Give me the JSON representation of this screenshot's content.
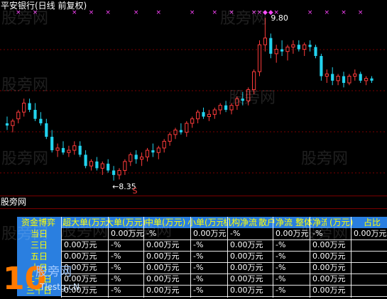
{
  "header": {
    "title": "平安银行(日线 前复权)"
  },
  "chart": {
    "high_label": "9.80",
    "low_label": "←8.35",
    "marker_label": "S",
    "colors": {
      "up": "#ff3b3b",
      "down": "#22d3ee",
      "marker": "#ff44ff",
      "grid": "#7a0000"
    },
    "candles": [
      {
        "o": 8.86,
        "h": 8.92,
        "l": 8.8,
        "c": 8.84
      },
      {
        "o": 8.84,
        "h": 8.9,
        "l": 8.78,
        "c": 8.88
      },
      {
        "o": 8.9,
        "h": 8.98,
        "l": 8.86,
        "c": 8.96
      },
      {
        "o": 8.96,
        "h": 9.08,
        "l": 8.92,
        "c": 9.04
      },
      {
        "o": 9.04,
        "h": 9.08,
        "l": 8.96,
        "c": 8.98
      },
      {
        "o": 8.98,
        "h": 9.04,
        "l": 8.88,
        "c": 8.9
      },
      {
        "o": 8.9,
        "h": 8.96,
        "l": 8.84,
        "c": 8.86
      },
      {
        "o": 8.86,
        "h": 8.9,
        "l": 8.72,
        "c": 8.74
      },
      {
        "o": 8.74,
        "h": 8.8,
        "l": 8.6,
        "c": 8.62
      },
      {
        "o": 8.62,
        "h": 8.68,
        "l": 8.56,
        "c": 8.64
      },
      {
        "o": 8.64,
        "h": 8.7,
        "l": 8.58,
        "c": 8.6
      },
      {
        "o": 8.6,
        "h": 8.66,
        "l": 8.56,
        "c": 8.62
      },
      {
        "o": 8.62,
        "h": 8.7,
        "l": 8.58,
        "c": 8.66
      },
      {
        "o": 8.66,
        "h": 8.7,
        "l": 8.56,
        "c": 8.58
      },
      {
        "o": 8.58,
        "h": 8.62,
        "l": 8.46,
        "c": 8.48
      },
      {
        "o": 8.48,
        "h": 8.54,
        "l": 8.44,
        "c": 8.52
      },
      {
        "o": 8.52,
        "h": 8.56,
        "l": 8.44,
        "c": 8.46
      },
      {
        "o": 8.46,
        "h": 8.52,
        "l": 8.4,
        "c": 8.5
      },
      {
        "o": 8.5,
        "h": 8.54,
        "l": 8.42,
        "c": 8.44
      },
      {
        "o": 8.44,
        "h": 8.48,
        "l": 8.35,
        "c": 8.4
      },
      {
        "o": 8.4,
        "h": 8.46,
        "l": 8.36,
        "c": 8.44
      },
      {
        "o": 8.44,
        "h": 8.54,
        "l": 8.4,
        "c": 8.52
      },
      {
        "o": 8.52,
        "h": 8.6,
        "l": 8.48,
        "c": 8.58
      },
      {
        "o": 8.58,
        "h": 8.62,
        "l": 8.5,
        "c": 8.54
      },
      {
        "o": 8.54,
        "h": 8.6,
        "l": 8.48,
        "c": 8.56
      },
      {
        "o": 8.56,
        "h": 8.64,
        "l": 8.52,
        "c": 8.62
      },
      {
        "o": 8.62,
        "h": 8.68,
        "l": 8.56,
        "c": 8.6
      },
      {
        "o": 8.6,
        "h": 8.66,
        "l": 8.54,
        "c": 8.64
      },
      {
        "o": 8.64,
        "h": 8.72,
        "l": 8.6,
        "c": 8.7
      },
      {
        "o": 8.7,
        "h": 8.78,
        "l": 8.66,
        "c": 8.76
      },
      {
        "o": 8.76,
        "h": 8.82,
        "l": 8.72,
        "c": 8.8
      },
      {
        "o": 8.8,
        "h": 8.86,
        "l": 8.76,
        "c": 8.78
      },
      {
        "o": 8.78,
        "h": 8.88,
        "l": 8.74,
        "c": 8.86
      },
      {
        "o": 8.86,
        "h": 8.92,
        "l": 8.82,
        "c": 8.9
      },
      {
        "o": 8.9,
        "h": 8.98,
        "l": 8.86,
        "c": 8.96
      },
      {
        "o": 8.96,
        "h": 9.0,
        "l": 8.9,
        "c": 8.92
      },
      {
        "o": 8.92,
        "h": 8.98,
        "l": 8.88,
        "c": 8.94
      },
      {
        "o": 8.94,
        "h": 9.0,
        "l": 8.9,
        "c": 8.98
      },
      {
        "o": 8.98,
        "h": 9.04,
        "l": 8.94,
        "c": 9.02
      },
      {
        "o": 9.02,
        "h": 9.06,
        "l": 8.96,
        "c": 8.98
      },
      {
        "o": 8.98,
        "h": 9.04,
        "l": 8.94,
        "c": 9.02
      },
      {
        "o": 9.02,
        "h": 9.1,
        "l": 8.98,
        "c": 9.08
      },
      {
        "o": 9.08,
        "h": 9.14,
        "l": 9.02,
        "c": 9.06
      },
      {
        "o": 9.06,
        "h": 9.18,
        "l": 9.02,
        "c": 9.16
      },
      {
        "o": 9.16,
        "h": 9.34,
        "l": 9.12,
        "c": 9.32
      },
      {
        "o": 9.32,
        "h": 9.6,
        "l": 9.28,
        "c": 9.56
      },
      {
        "o": 9.56,
        "h": 9.8,
        "l": 9.5,
        "c": 9.62
      },
      {
        "o": 9.62,
        "h": 9.66,
        "l": 9.44,
        "c": 9.48
      },
      {
        "o": 9.48,
        "h": 9.56,
        "l": 9.4,
        "c": 9.52
      },
      {
        "o": 9.52,
        "h": 9.6,
        "l": 9.46,
        "c": 9.5
      },
      {
        "o": 9.5,
        "h": 9.56,
        "l": 9.42,
        "c": 9.54
      },
      {
        "o": 9.54,
        "h": 9.6,
        "l": 9.48,
        "c": 9.56
      },
      {
        "o": 9.56,
        "h": 9.6,
        "l": 9.5,
        "c": 9.52
      },
      {
        "o": 9.52,
        "h": 9.58,
        "l": 9.46,
        "c": 9.56
      },
      {
        "o": 9.56,
        "h": 9.6,
        "l": 9.5,
        "c": 9.54
      },
      {
        "o": 9.54,
        "h": 9.56,
        "l": 9.44,
        "c": 9.46
      },
      {
        "o": 9.46,
        "h": 9.48,
        "l": 9.24,
        "c": 9.28
      },
      {
        "o": 9.28,
        "h": 9.34,
        "l": 9.22,
        "c": 9.3
      },
      {
        "o": 9.3,
        "h": 9.36,
        "l": 9.2,
        "c": 9.24
      },
      {
        "o": 9.24,
        "h": 9.3,
        "l": 9.2,
        "c": 9.28
      },
      {
        "o": 9.28,
        "h": 9.32,
        "l": 9.18,
        "c": 9.22
      },
      {
        "o": 9.22,
        "h": 9.3,
        "l": 9.2,
        "c": 9.28
      },
      {
        "o": 9.28,
        "h": 9.34,
        "l": 9.24,
        "c": 9.3
      },
      {
        "o": 9.3,
        "h": 9.32,
        "l": 9.22,
        "c": 9.24
      },
      {
        "o": 9.24,
        "h": 9.28,
        "l": 9.2,
        "c": 9.26
      },
      {
        "o": 9.26,
        "h": 9.28,
        "l": 9.22,
        "c": 9.24
      }
    ],
    "top_markers": [
      {
        "i": 2,
        "k": "x"
      },
      {
        "i": 5,
        "k": "x"
      },
      {
        "i": 12,
        "k": "x"
      },
      {
        "i": 15,
        "k": "x"
      },
      {
        "i": 18,
        "k": "x"
      },
      {
        "i": 23,
        "k": "x"
      },
      {
        "i": 27,
        "k": "x"
      },
      {
        "i": 33,
        "k": "x"
      },
      {
        "i": 37,
        "k": "x"
      },
      {
        "i": 40,
        "k": "x"
      },
      {
        "i": 44,
        "k": "x"
      },
      {
        "i": 45,
        "k": "x"
      },
      {
        "i": 46,
        "k": "d"
      },
      {
        "i": 47,
        "k": "d"
      },
      {
        "i": 48,
        "k": "x"
      },
      {
        "i": 54,
        "k": "x"
      },
      {
        "i": 57,
        "k": "x"
      },
      {
        "i": 60,
        "k": "x"
      },
      {
        "i": 63,
        "k": "x"
      }
    ]
  },
  "panel": {
    "label": "股旁网"
  },
  "table": {
    "headers": [
      "资金博弈",
      "超大单(万元)",
      "大单(万元)",
      "中单(万元)",
      "小单(万元)",
      "机构净流",
      "散户净流",
      "整体净流",
      "(万元)",
      "占比"
    ],
    "rows": [
      {
        "label": "当日",
        "cells": [
          {
            "text": "0.00万元",
            "col": 1
          },
          {
            "text": "-%",
            "col": 2
          },
          {
            "text": "0.00万元",
            "col": 3
          },
          {
            "text": "-%",
            "col": 4
          },
          {
            "text": "0.00万元",
            "col": 5
          },
          {
            "text": "-%",
            "col": 6
          },
          {
            "text": "0.00万元",
            "col": 7
          }
        ]
      },
      {
        "label": "三日",
        "cells": [
          {
            "text": "0.00万元",
            "col": 0
          },
          {
            "text": "-%",
            "col": 1
          },
          {
            "text": "0.00万元",
            "col": 2
          },
          {
            "text": "-%",
            "col": 3
          },
          {
            "text": "0.00万元",
            "col": 4
          },
          {
            "text": "-%",
            "col": 5
          },
          {
            "text": "0.00万元",
            "col": 6
          }
        ]
      },
      {
        "label": "五日",
        "cells": [
          {
            "text": "0.00万元",
            "col": 0
          },
          {
            "text": "-%",
            "col": 1
          },
          {
            "text": "0.00万元",
            "col": 2
          },
          {
            "text": "-%",
            "col": 3
          },
          {
            "text": "0.00万元",
            "col": 4
          },
          {
            "text": "-%",
            "col": 5
          },
          {
            "text": "0.00万元",
            "col": 6
          }
        ]
      },
      {
        "label": "十日",
        "cells": [
          {
            "text": "0.00万元",
            "col": 0
          },
          {
            "text": "-%",
            "col": 1
          },
          {
            "text": "0.00万元",
            "col": 2
          },
          {
            "text": "-%",
            "col": 3
          },
          {
            "text": "0.00万元",
            "col": 4
          },
          {
            "text": "-%",
            "col": 5
          },
          {
            "text": "0.00万元",
            "col": 6
          }
        ]
      },
      {
        "label": "二十日",
        "cells": [
          {
            "text": "0.00万元",
            "col": 0
          },
          {
            "text": "-%",
            "col": 1
          },
          {
            "text": "0.00万元",
            "col": 2
          },
          {
            "text": "-%",
            "col": 3
          },
          {
            "text": "0.00万元",
            "col": 4
          },
          {
            "text": "-%",
            "col": 5
          },
          {
            "text": "0.00万元",
            "col": 6
          }
        ]
      },
      {
        "label": "三十日",
        "cells": [
          {
            "text": "0.00万元",
            "col": 0
          },
          {
            "text": "-%",
            "col": 1
          },
          {
            "text": "0.00万元",
            "col": 2
          },
          {
            "text": "-%",
            "col": 3
          },
          {
            "text": "0.00万元",
            "col": 4
          },
          {
            "text": "-%",
            "col": 5
          },
          {
            "text": "0.00万元",
            "col": 6
          }
        ]
      }
    ]
  },
  "watermarks": [
    "股旁网",
    "股旁网",
    "股旁网",
    "股旁网",
    "股旁网",
    "股旁网",
    "股旁网",
    "股旁网",
    "股旁网",
    "股旁网"
  ],
  "logo": {
    "number": "10",
    "cn": "股旁网",
    "en": "Tlestg.cN"
  }
}
